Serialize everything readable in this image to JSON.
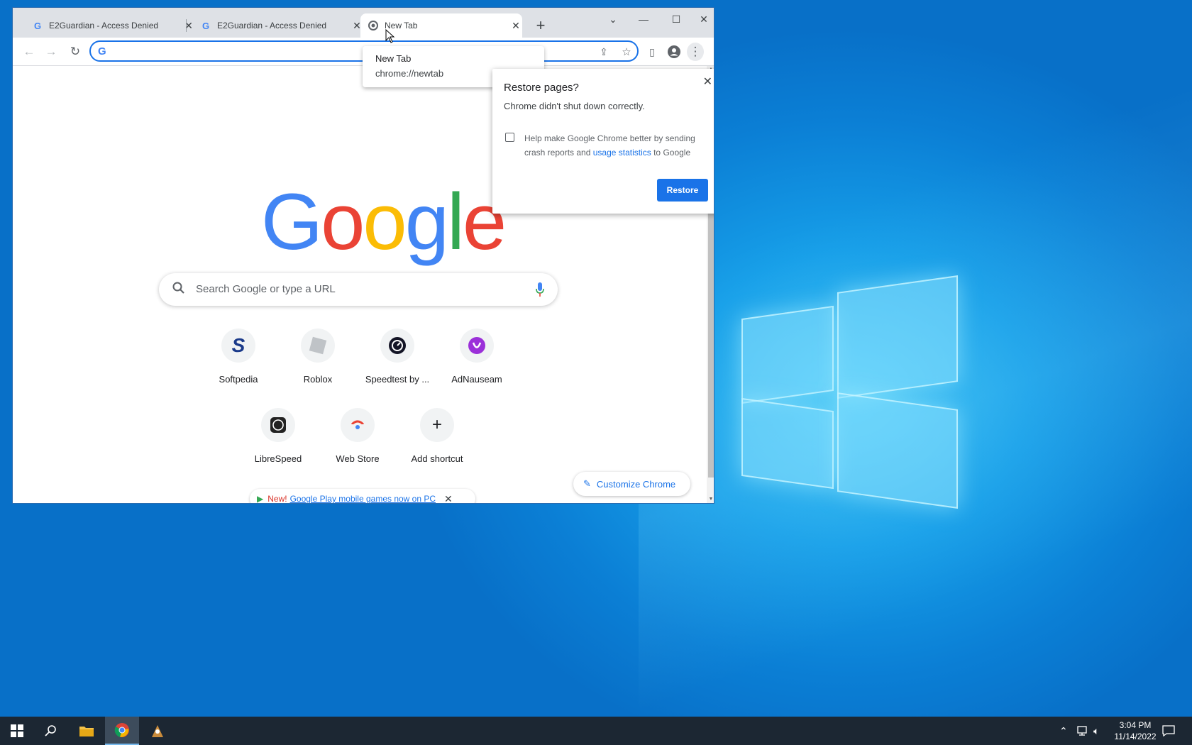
{
  "tabs": [
    {
      "title": "E2Guardian - Access Denied",
      "favicon": "G"
    },
    {
      "title": "E2Guardian - Access Denied",
      "favicon": "G"
    },
    {
      "title": "New Tab",
      "favicon": "chrome"
    }
  ],
  "hovercard": {
    "title": "New Tab",
    "url": "chrome://newtab"
  },
  "restore": {
    "title": "Restore pages?",
    "subtitle": "Chrome didn't shut down correctly.",
    "checkbox_text_1": "Help make Google Chrome better by sending crash reports and ",
    "checkbox_link": "usage statistics",
    "checkbox_text_2": " to Google",
    "button": "Restore"
  },
  "search": {
    "placeholder": "Search Google or type a URL"
  },
  "shortcuts": [
    {
      "label": "Softpedia"
    },
    {
      "label": "Roblox"
    },
    {
      "label": "Speedtest by ..."
    },
    {
      "label": "AdNauseam"
    },
    {
      "label": "LibreSpeed"
    },
    {
      "label": "Web Store"
    },
    {
      "label": "Add shortcut"
    }
  ],
  "customize": {
    "label": "Customize Chrome"
  },
  "promo": {
    "new": "New!",
    "link": "Google Play mobile games now on PC"
  },
  "clock": {
    "time": "3:04 PM",
    "date": "11/14/2022"
  },
  "colors": {
    "accent": "#1a73e8",
    "taskbar": "#1c2733"
  }
}
